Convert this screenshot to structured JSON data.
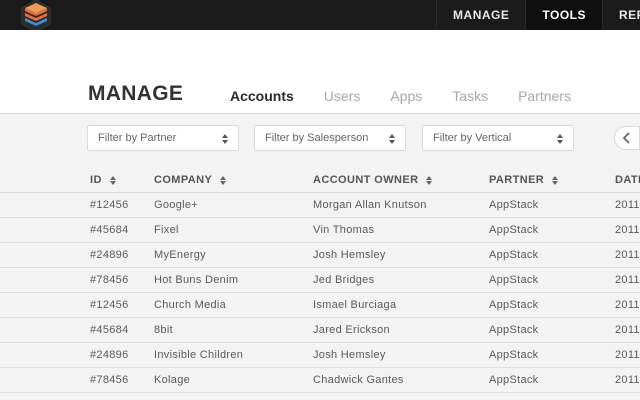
{
  "topnav": [
    "MANAGE",
    "TOOLS",
    "REPORTS"
  ],
  "page_title": "MANAGE",
  "tabs": [
    "Accounts",
    "Users",
    "Apps",
    "Tasks",
    "Partners"
  ],
  "filters": {
    "partner": "Filter by Partner",
    "salesperson": "Filter by Salesperson",
    "vertical": "Filter by Vertical"
  },
  "table": {
    "headers": [
      "ID",
      "COMPANY",
      "ACCOUNT OWNER",
      "PARTNER",
      "DATE"
    ],
    "rows": [
      {
        "id": "#12456",
        "company": "Google+",
        "owner": "Morgan Allan Knutson",
        "partner": "AppStack",
        "date": "2011"
      },
      {
        "id": "#45684",
        "company": "Fixel",
        "owner": "Vin Thomas",
        "partner": "AppStack",
        "date": "2011"
      },
      {
        "id": "#24896",
        "company": "MyEnergy",
        "owner": "Josh Hemsley",
        "partner": "AppStack",
        "date": "2011"
      },
      {
        "id": "#78456",
        "company": "Hot Buns Denim",
        "owner": "Jed Bridges",
        "partner": "AppStack",
        "date": "2011"
      },
      {
        "id": "#12456",
        "company": "Church Media",
        "owner": "Ismael Burciaga",
        "partner": "AppStack",
        "date": "2011"
      },
      {
        "id": "#45684",
        "company": "8bit",
        "owner": "Jared Erickson",
        "partner": "AppStack",
        "date": "2011"
      },
      {
        "id": "#24896",
        "company": "Invisible Children",
        "owner": "Josh Hemsley",
        "partner": "AppStack",
        "date": "2011"
      },
      {
        "id": "#78456",
        "company": "Kolage",
        "owner": "Chadwick Gantes",
        "partner": "AppStack",
        "date": "2011"
      }
    ]
  },
  "colors": {
    "topbar": "#1b1b1b",
    "logo_orange": "#e8703a",
    "logo_blue": "#3a8ed8",
    "background": "#f3f3f3"
  },
  "icons": {
    "logo": "layered-stack-logo",
    "sort": "sort-arrows-icon",
    "select": "select-caret-icon",
    "prev": "chevron-left-icon"
  }
}
